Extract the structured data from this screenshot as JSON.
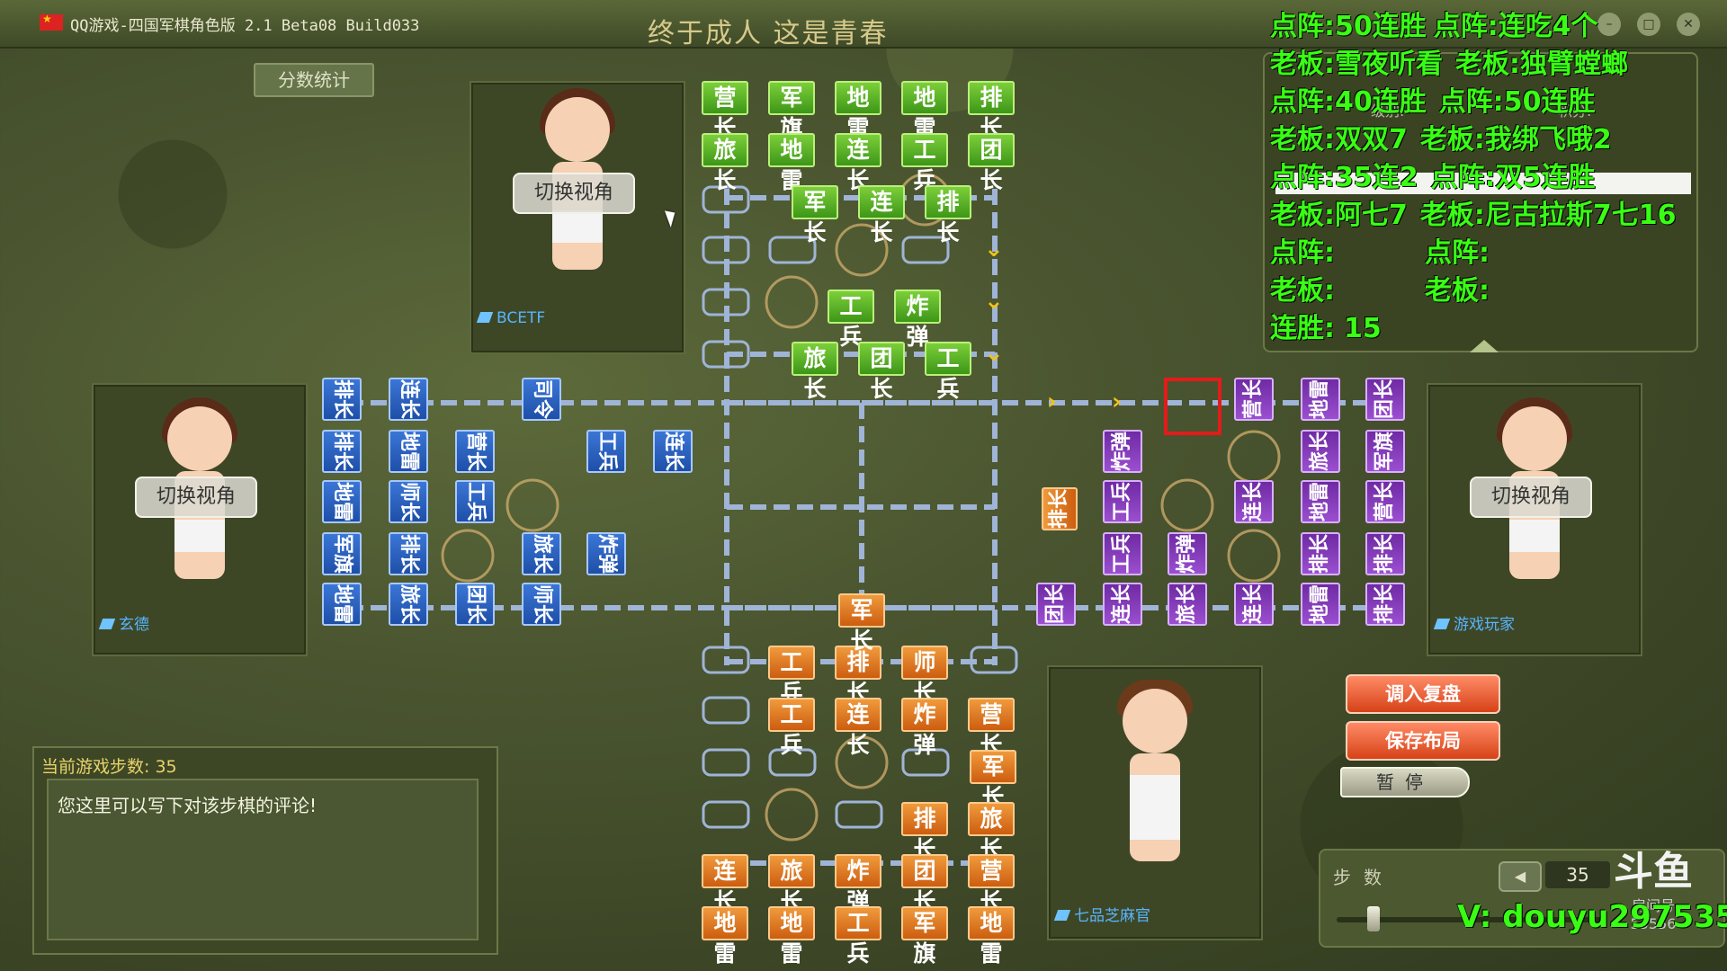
{
  "window": {
    "app_title": "QQ游戏-四国军棋角色版 2.1 Beta08 Build033",
    "subtitle": "终于成人 这是青春"
  },
  "overlay": {
    "line1a": "点阵:50连胜",
    "line1b": "点阵:",
    "line1c": "连吃4个",
    "line2a": "老板:",
    "line2b": "雪夜听看",
    "line2c": "老板:",
    "line2d": "独臂螳螂",
    "line3a": "点阵:",
    "line3b": "40连胜",
    "line3c": "点阵:",
    "line3d": "50连胜",
    "line4a": "老板:",
    "line4b": "双双7",
    "line4c": "老板:",
    "line4d": "我绑飞哦2",
    "line5a": "点阵:",
    "line5b": "35连2",
    "line5c": "点阵:",
    "line5d": "双5连胜",
    "line6a": "老板:",
    "line6b": "阿七7",
    "line6c": "老板:",
    "line6d": "尼古拉斯7七16",
    "line7a": "点阵:",
    "line7c": "点阵:",
    "line8a": "老板:",
    "line8c": "老板:",
    "line9a": "连胜:",
    "line9b": "15",
    "watermark": "V: douyu297535"
  },
  "left_panel": {
    "score_button": "分数统计"
  },
  "players": {
    "top": {
      "switch_label": "切换视角",
      "name": "BCETF"
    },
    "left": {
      "switch_label": "切换视角",
      "name": "玄德"
    },
    "right": {
      "switch_label": "切换视角",
      "name": "游戏玩家"
    },
    "bottom": {
      "name": "七品芝麻官"
    }
  },
  "board": {
    "top_green": [
      [
        "营长",
        "军旗",
        "地雷",
        "地雷",
        "排长"
      ],
      [
        "旅长",
        "地雷",
        "连长",
        "工兵",
        "团长"
      ],
      [
        "军长",
        "连长",
        "排长"
      ],
      [
        "工兵",
        "炸弹"
      ],
      [
        "旅长",
        "团长",
        "工兵"
      ]
    ],
    "bottom_orange": [
      [
        "工兵",
        "排长",
        "师长"
      ],
      [
        "工兵",
        "连长",
        "炸弹",
        "营长"
      ],
      [
        "军长"
      ],
      [
        "排长",
        "旅长"
      ],
      [
        "连长",
        "旅长",
        "炸弹",
        "团长",
        "营长"
      ],
      [
        "地雷",
        "地雷",
        "工兵",
        "军旗",
        "地雷"
      ]
    ],
    "center_orange": "军长",
    "left_blue": [
      [
        "排长",
        "连长",
        "司令"
      ],
      [
        "排长",
        "地雷",
        "营长",
        "工兵",
        "连长"
      ],
      [
        "地雷",
        "师长",
        "工兵"
      ],
      [
        "军旗",
        "排长",
        "旅长",
        "炸弹"
      ],
      [
        "地雷",
        "旅长",
        "团长",
        "师长"
      ]
    ],
    "right_purple": [
      [
        "营长",
        "地雷",
        "团长"
      ],
      [
        "炸弹",
        "旅长",
        "军旗"
      ],
      [
        "工兵",
        "连长",
        "地雷",
        "营长"
      ],
      [
        "工兵",
        "炸弹",
        "排长",
        "排长"
      ],
      [
        "团长",
        "连长",
        "旅长",
        "连长",
        "地雷",
        "排长"
      ]
    ],
    "right_orange": "排长"
  },
  "comment": {
    "step_label": "当前游戏步数: 35",
    "placeholder_text": "您这里可以写下对该步棋的评论!"
  },
  "controls": {
    "load_replay": "调入复盘",
    "save_layout": "保存布局",
    "pause": "暂停",
    "steps_label": "步数",
    "prev_icon": "◀",
    "step_value": "35"
  },
  "room": {
    "logo": "斗鱼",
    "label": "房间号",
    "number": "55556"
  },
  "score_info": {
    "label_rank": "级别:",
    "label_points": "积分:"
  }
}
